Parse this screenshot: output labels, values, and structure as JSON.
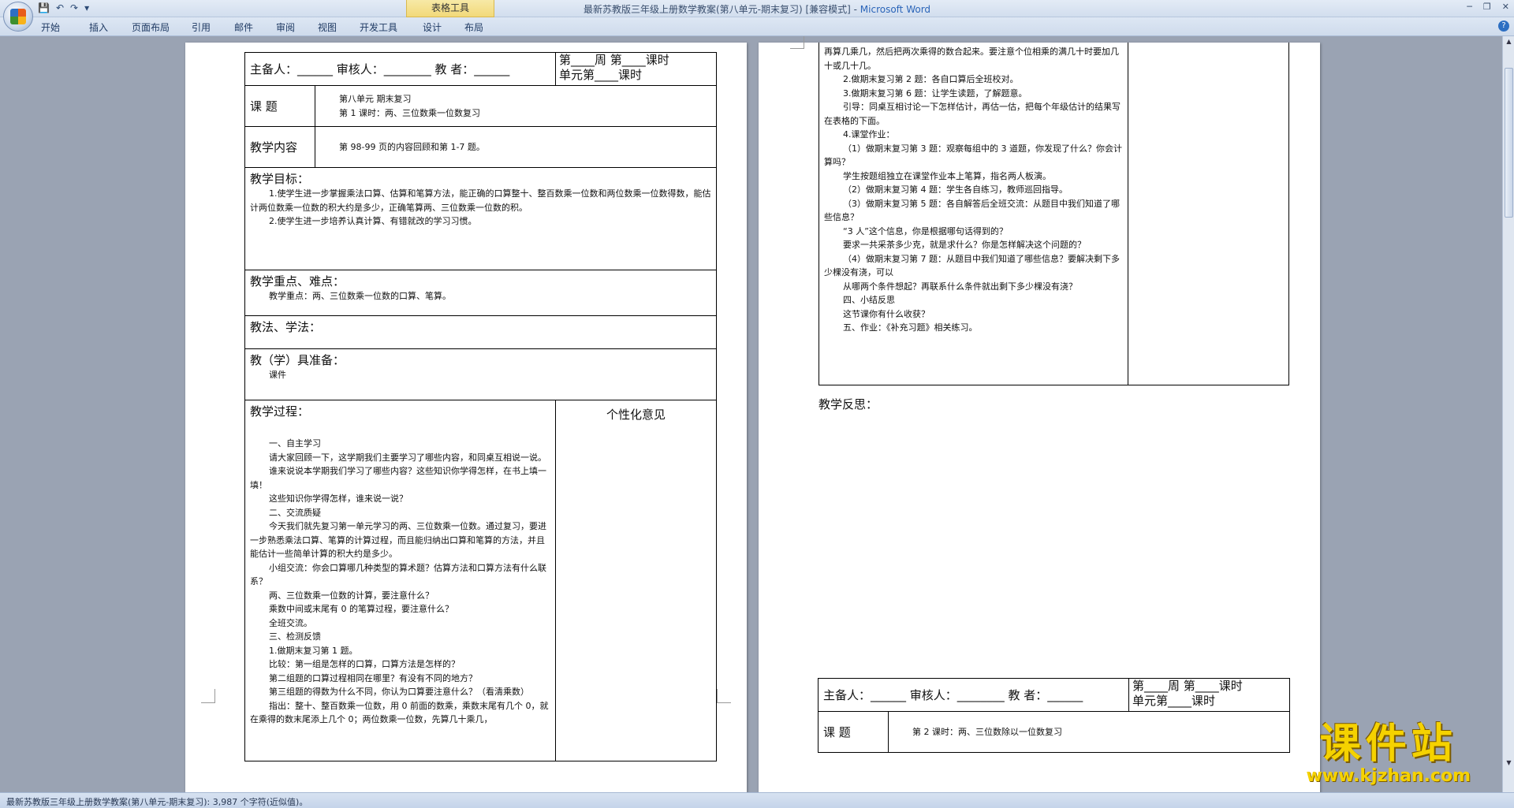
{
  "window": {
    "title": "最新苏教版三年级上册数学教案(第八单元-期末复习) [兼容模式]",
    "separator": " - ",
    "app_name": "Microsoft Word",
    "contextual_group": "表格工具"
  },
  "ribbon": {
    "tabs": [
      "开始",
      "插入",
      "页面布局",
      "引用",
      "邮件",
      "审阅",
      "视图",
      "开发工具",
      "设计",
      "布局"
    ]
  },
  "status_bar": {
    "text": "最新苏教版三年级上册数学教案(第八单元-期末复习): 3,987 个字符(近似值)。"
  },
  "page1": {
    "header": {
      "preparer": "主备人：______  审核人：________  教    者：______",
      "week": "第____周 第____课时",
      "unit": "单元第____课时"
    },
    "topic_label": "课    题",
    "topic_lines": [
      "第八单元 期末复习",
      "第 1 课时：两、三位数乘一位数复习"
    ],
    "content_label": "教学内容",
    "content_text": "第 98-99 页的内容回顾和第 1-7 题。",
    "objectives_label": "教学目标：",
    "objectives": [
      "1.使学生进一步掌握乘法口算、估算和笔算方法，能正确的口算整十、整百数乘一位数和两位数乘一位数得数，能估计两位数乘一位数的积大约是多少，正确笔算两、三位数乘一位数的积。",
      "2.使学生进一步培养认真计算、有错就改的学习习惯。"
    ],
    "key_label": "教学重点、难点：",
    "key_text": "教学重点：两、三位数乘一位数的口算、笔算。",
    "method_label": "教法、学法：",
    "tools_label": "教（学）具准备：",
    "tools_text": "课件",
    "process_label": "教学过程：",
    "personal_label": "个性化意见",
    "process": [
      "一、自主学习",
      "请大家回顾一下，这学期我们主要学习了哪些内容，和同桌互相说一说。",
      "谁来说说本学期我们学习了哪些内容？这些知识你学得怎样，在书上填一填！",
      "这些知识你学得怎样，谁来说一说？",
      "二、交流质疑",
      "今天我们就先复习第一单元学习的两、三位数乘一位数。通过复习，要进一步熟悉乘法口算、笔算的计算过程，而且能归纳出口算和笔算的方法，并且能估计一些简单计算的积大约是多少。",
      "小组交流：你会口算哪几种类型的算术题？估算方法和口算方法有什么联系？",
      "两、三位数乘一位数的计算，要注意什么？",
      "乘数中间或末尾有 0 的笔算过程，要注意什么？",
      "全班交流。",
      "三、检测反馈",
      "1.做期末复习第 1 题。",
      "比较：第一组是怎样的口算，口算方法是怎样的？",
      "第二组题的口算过程相同在哪里？有没有不同的地方？",
      "第三组题的得数为什么不同，你认为口算要注意什么？（看清乘数）",
      "指出：整十、整百数乘一位数，用 0 前面的数乘，乘数末尾有几个 0，就在乘得的数末尾添上几个 0；两位数乘一位数，先算几十乘几，"
    ]
  },
  "page2": {
    "process": [
      "再算几乘几，然后把两次乘得的数合起来。要注意个位相乘的满几十时要加几十或几十几。",
      "2.做期末复习第 2 题：各自口算后全班校对。",
      "3.做期末复习第 6 题：让学生读题，了解题意。",
      "引导：同桌互相讨论一下怎样估计，再估一估，把每个年级估计的结果写在表格的下面。",
      "4.课堂作业：",
      "（1）做期末复习第 3 题：观察每组中的 3 道题，你发现了什么？你会计算吗？",
      "学生按题组独立在课堂作业本上笔算，指名两人板演。",
      "（2）做期末复习第 4 题：学生各自练习，教师巡回指导。",
      "（3）做期末复习第 5 题：各自解答后全班交流：从题目中我们知道了哪些信息？",
      "“3 人”这个信息，你是根据哪句话得到的？",
      "要求一共采茶多少克，就是求什么？你是怎样解决这个问题的？",
      "（4）做期末复习第 7 题：从题目中我们知道了哪些信息？要解决剩下多少棵没有浇，可以",
      "从哪两个条件想起？再联系什么条件就出剩下多少棵没有浇？",
      "四、小结反思",
      "这节课你有什么收获？",
      "五、作业：《补充习题》相关练习。"
    ],
    "reflection_label": "教学反思：",
    "header": {
      "preparer": "主备人：______  审核人：________  教    者：______",
      "week": "第____周 第____课时",
      "unit": "单元第____课时"
    },
    "topic_label": "课    题",
    "topic_text": "第 2 课时：两、三位数除以一位数复习"
  },
  "watermark": {
    "main": "课件站",
    "url": "www.kjzhan.com"
  }
}
